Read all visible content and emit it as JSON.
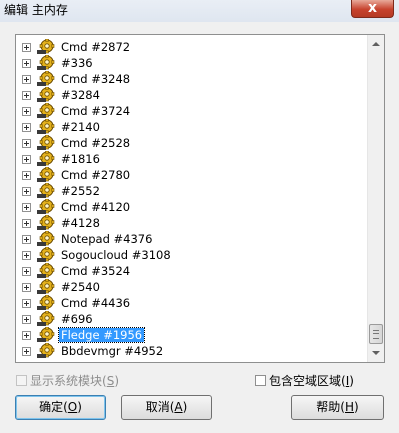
{
  "window": {
    "title": "编辑 主内存",
    "close_label": "x"
  },
  "tree": {
    "items": [
      {
        "label": "Cmd #2872"
      },
      {
        "label": "#336"
      },
      {
        "label": "Cmd #3248"
      },
      {
        "label": "#3284"
      },
      {
        "label": "Cmd #3724"
      },
      {
        "label": "#2140"
      },
      {
        "label": "Cmd #2528"
      },
      {
        "label": "#1816"
      },
      {
        "label": "Cmd #2780"
      },
      {
        "label": "#2552"
      },
      {
        "label": "Cmd #4120"
      },
      {
        "label": "#4128"
      },
      {
        "label": "Notepad #4376"
      },
      {
        "label": "Sogoucloud #3108"
      },
      {
        "label": "Cmd #3524"
      },
      {
        "label": "#2540"
      },
      {
        "label": "Cmd #4436"
      },
      {
        "label": "#696"
      },
      {
        "label": "Fledge #1956",
        "selected": true
      },
      {
        "label": "Bbdevmgr #4952"
      }
    ],
    "icon": "gear-process-icon"
  },
  "options": {
    "show_system_modules": {
      "label": "显示系统模块(",
      "key": "S",
      "suffix": ")",
      "checked": false,
      "enabled": false
    },
    "include_empty_regions": {
      "label": "包含空域区域(",
      "key": "I",
      "suffix": ")",
      "checked": false,
      "enabled": true
    }
  },
  "buttons": {
    "ok": {
      "label": "确定(",
      "key": "O",
      "suffix": ")"
    },
    "cancel": {
      "label": "取消(",
      "key": "A",
      "suffix": ")"
    },
    "help": {
      "label": "帮助(",
      "key": "H",
      "suffix": ")"
    }
  },
  "colors": {
    "selection": "#3399ff",
    "close_button": "#c7432e",
    "dialog_bg": "#f0f0f0"
  }
}
